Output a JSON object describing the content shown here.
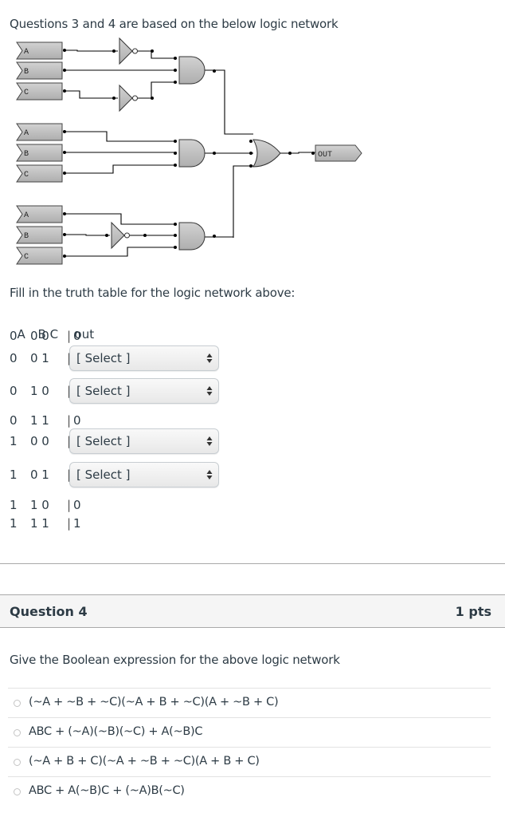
{
  "intro": "Questions 3 and 4 are based on the below logic network",
  "circuit": {
    "inputs_group1": [
      "A",
      "B",
      "C"
    ],
    "inputs_group2": [
      "A",
      "B",
      "C"
    ],
    "inputs_group3": [
      "A",
      "B",
      "C"
    ],
    "output_label": "OUT",
    "colors": {
      "gate_fill": "#c0c0c0",
      "wire": "#000000"
    }
  },
  "question3": {
    "prompt": "Fill in the truth table for the logic network above:",
    "header": {
      "a": "A",
      "bc": "B C",
      "out": "out"
    },
    "rows": [
      {
        "a": "0",
        "bc": "0 0",
        "sep": "|",
        "out": "0",
        "select": false
      },
      {
        "a": "0",
        "bc": "0 1",
        "sep": "|",
        "out": "",
        "select": true,
        "select_value": "[ Select ]"
      },
      {
        "a": "0",
        "bc": "1 0",
        "sep": "|",
        "out": "",
        "select": true,
        "select_value": "[ Select ]"
      },
      {
        "a": "0",
        "bc": "1 1",
        "sep": "|",
        "out": "0",
        "select": false
      },
      {
        "a": "1",
        "bc": "0 0",
        "sep": "|",
        "out": "",
        "select": true,
        "select_value": "[ Select ]"
      },
      {
        "a": "1",
        "bc": "0 1",
        "sep": "|",
        "out": "",
        "select": true,
        "select_value": "[ Select ]"
      },
      {
        "a": "1",
        "bc": "1 0",
        "sep": "|",
        "out": "0",
        "select": false
      },
      {
        "a": "1",
        "bc": "1 1",
        "sep": "|",
        "out": "1",
        "select": false
      }
    ]
  },
  "question4": {
    "title": "Question 4",
    "points": "1 pts",
    "prompt": "Give the Boolean expression for the above logic network",
    "answers": [
      "(~A + ~B + ~C)(~A + B + ~C)(A + ~B + C)",
      "ABC + (~A)(~B)(~C) + A(~B)C",
      "(~A + B + C)(~A + ~B + ~C)(A + B + C)",
      "ABC + A(~B)C + (~A)B(~C)"
    ]
  }
}
